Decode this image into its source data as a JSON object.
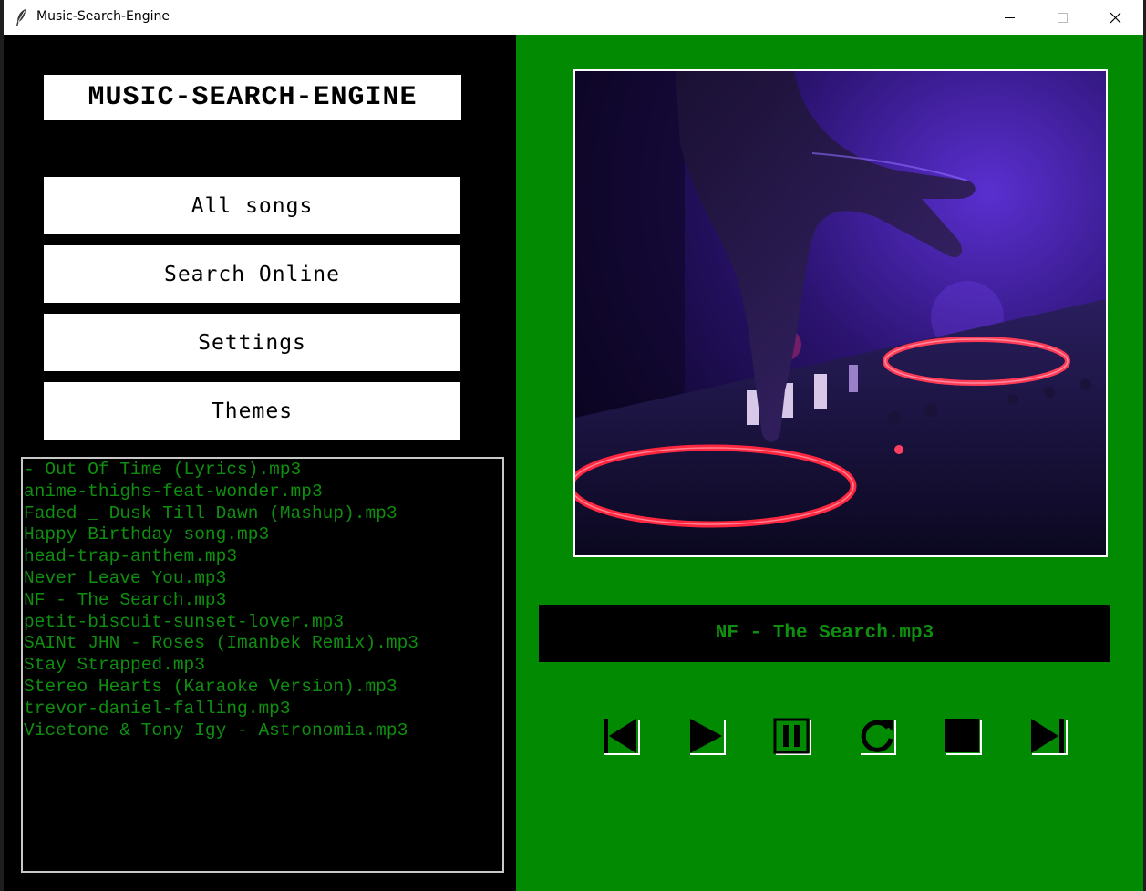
{
  "window": {
    "title": "Music-Search-Engine",
    "controls": [
      "minimize",
      "maximize",
      "close"
    ]
  },
  "header": {
    "app_title": "MUSIC-SEARCH-ENGINE"
  },
  "menu": {
    "items": [
      {
        "label": "All songs"
      },
      {
        "label": "Search Online"
      },
      {
        "label": "Settings"
      },
      {
        "label": "Themes"
      }
    ]
  },
  "playlist": {
    "songs": [
      "- Out Of Time (Lyrics).mp3",
      "anime-thighs-feat-wonder.mp3",
      "Faded _ Dusk Till Dawn (Mashup).mp3",
      "Happy Birthday song.mp3",
      "head-trap-anthem.mp3",
      "Never Leave You.mp3",
      "NF - The Search.mp3",
      "petit-biscuit-sunset-lover.mp3",
      "SAINt JHN - Roses (Imanbek Remix).mp3",
      "Stay Strapped.mp3",
      "Stereo Hearts (Karaoke Version).mp3",
      "trevor-daniel-falling.mp3",
      "Vicetone & Tony Igy - Astronomia.mp3"
    ]
  },
  "player": {
    "now_playing": "NF - The Search.mp3",
    "album_art": "dj-mixer-hand-photo",
    "controls": [
      {
        "icon": "skip-previous-icon"
      },
      {
        "icon": "play-icon"
      },
      {
        "icon": "pause-icon"
      },
      {
        "icon": "replay-icon"
      },
      {
        "icon": "stop-icon"
      },
      {
        "icon": "skip-next-icon"
      }
    ]
  },
  "colors": {
    "left_bg": "#000000",
    "right_bg": "#038a03",
    "song_text": "#0f8f0f",
    "button_bg": "#ffffff"
  }
}
